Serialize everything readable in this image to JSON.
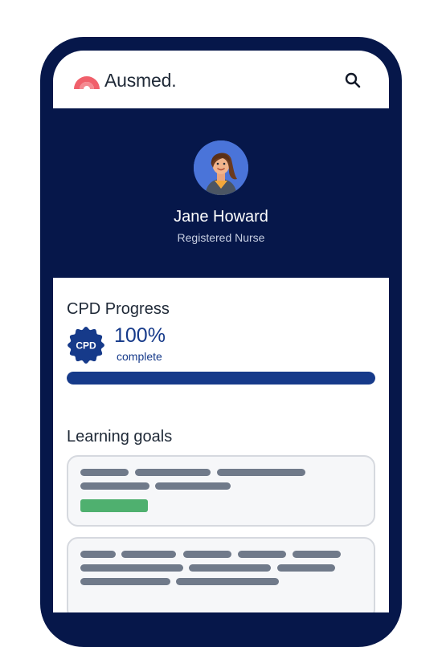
{
  "app": {
    "brand": "Ausmed",
    "brand_color": "#f0606b",
    "search_icon": "search-icon"
  },
  "profile": {
    "name": "Jane Howard",
    "role": "Registered Nurse"
  },
  "cpd": {
    "title": "CPD Progress",
    "badge_text": "CPD",
    "percent_text": "100%",
    "percent_label": "complete",
    "progress_value": 1.0,
    "accent_color": "#163a8a"
  },
  "goals": {
    "title": "Learning goals"
  },
  "colors": {
    "navy": "#06174a",
    "placeholder": "#707a8a",
    "status_green": "#4fb06f"
  }
}
